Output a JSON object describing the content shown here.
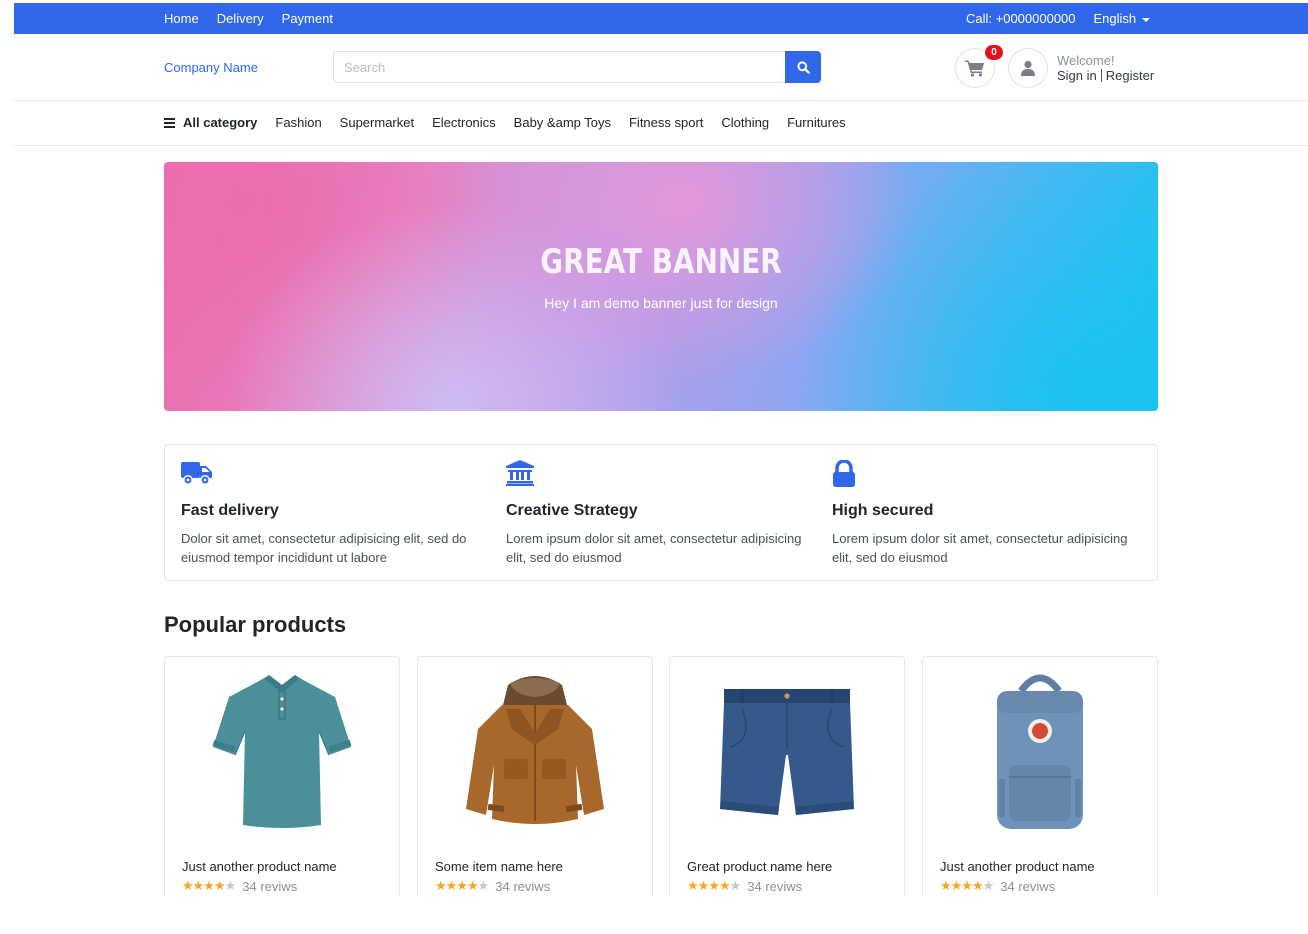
{
  "topbar": {
    "nav": [
      "Home",
      "Delivery",
      "Payment"
    ],
    "call": "Call: +0000000000",
    "language": "English"
  },
  "header": {
    "brand": "Company Name",
    "search_placeholder": "Search",
    "cart_count": "0",
    "welcome": "Welcome!",
    "sign_in": "Sign in",
    "register": "Register"
  },
  "categories": {
    "all": "All category",
    "items": [
      "Fashion",
      "Supermarket",
      "Electronics",
      "Baby &amp Toys",
      "Fitness sport",
      "Clothing",
      "Furnitures"
    ]
  },
  "banner": {
    "title": "GREAT BANNER",
    "subtitle": "Hey I am demo banner just for design"
  },
  "features": [
    {
      "icon": "truck-icon",
      "title": "Fast delivery",
      "text": "Dolor sit amet, consectetur adipisicing elit, sed do eiusmod tempor incididunt ut labore"
    },
    {
      "icon": "landmark-icon",
      "title": "Creative Strategy",
      "text": "Lorem ipsum dolor sit amet, consectetur adipisicing elit, sed do eiusmod"
    },
    {
      "icon": "lock-icon",
      "title": "High secured",
      "text": "Lorem ipsum dolor sit amet, consectetur adipisicing elit, sed do eiusmod"
    }
  ],
  "popular": {
    "title": "Popular products",
    "products": [
      {
        "name": "Just another product name",
        "reviews": "34 reviws",
        "rating": 4,
        "image": "polo-shirt-icon"
      },
      {
        "name": "Some item name here",
        "reviews": "34 reviws",
        "rating": 4,
        "image": "jacket-icon"
      },
      {
        "name": "Great product name here",
        "reviews": "34 reviws",
        "rating": 4,
        "image": "denim-shorts-icon"
      },
      {
        "name": "Just another product name",
        "reviews": "34 reviws",
        "rating": 4,
        "image": "backpack-icon"
      }
    ]
  },
  "colors": {
    "primary": "#3167eb",
    "badge": "#e4121a",
    "star": "#f5a623"
  }
}
